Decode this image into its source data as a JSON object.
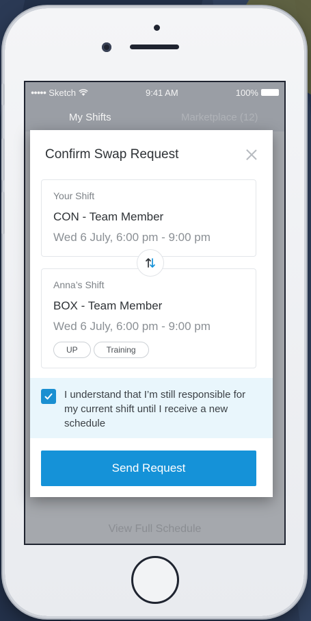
{
  "status_bar": {
    "carrier": "Sketch",
    "time": "9:41 AM",
    "battery": "100%"
  },
  "tabs": [
    {
      "label": "My Shifts"
    },
    {
      "label": "Marketplace (12)"
    }
  ],
  "background": {
    "footer_link": "View Full Schedule"
  },
  "modal": {
    "title": "Confirm Swap Request",
    "your_shift": {
      "label": "Your Shift",
      "role": "CON - Team Member",
      "time": "Wed 6 July, 6:00 pm - 9:00 pm"
    },
    "other_shift": {
      "label": "Anna’s Shift",
      "role": "BOX - Team Member",
      "time": "Wed 6 July, 6:00 pm - 9:00 pm",
      "tags": [
        "UP",
        "Training"
      ]
    },
    "consent": {
      "checked": true,
      "text": "I understand that I’m still responsible for my current shift until I receive a new schedule"
    },
    "send_label": "Send Request"
  },
  "colors": {
    "accent": "#1592d8",
    "checkbox": "#1a8fd1",
    "consent_bg": "#e9f6fc"
  }
}
